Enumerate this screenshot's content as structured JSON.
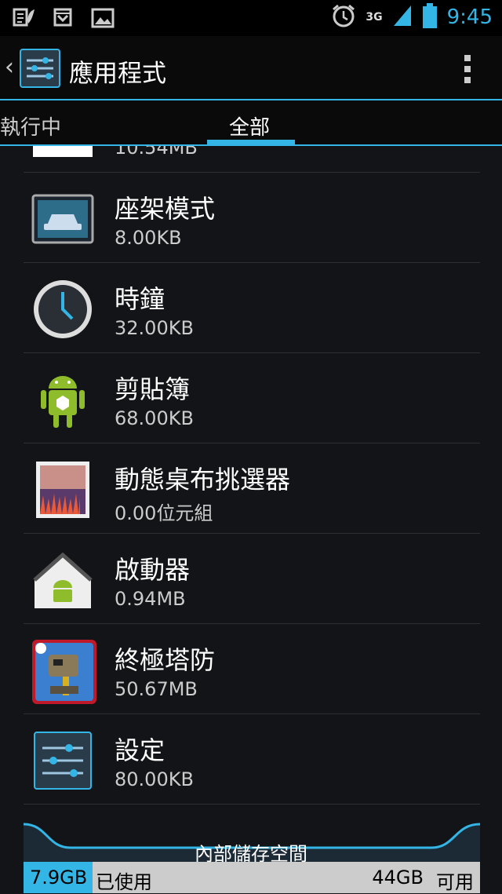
{
  "status_bar": {
    "time": "9:45",
    "network": "3G",
    "icons": [
      "sim-toolkit-icon",
      "download-done-icon",
      "picture-icon",
      "alarm-icon",
      "signal-icon",
      "battery-icon"
    ]
  },
  "action_bar": {
    "title": "應用程式",
    "icon": "settings-icon"
  },
  "tabs": [
    {
      "label": "執行中",
      "selected": false
    },
    {
      "label": "全部",
      "selected": true
    }
  ],
  "apps": [
    {
      "name": "",
      "size": "10.54MB",
      "icon": "app-icon-partial"
    },
    {
      "name": "座架模式",
      "size": "8.00KB",
      "icon": "car-dock-icon"
    },
    {
      "name": "時鐘",
      "size": "32.00KB",
      "icon": "clock-icon"
    },
    {
      "name": "剪貼簿",
      "size": "68.00KB",
      "icon": "android-clipboard-icon"
    },
    {
      "name": "動態桌布挑選器",
      "size": "0.00位元組",
      "icon": "live-wallpaper-icon"
    },
    {
      "name": "啟動器",
      "size": "0.94MB",
      "icon": "launcher-home-icon"
    },
    {
      "name": "終極塔防",
      "size": "50.67MB",
      "icon": "tower-defense-game-icon"
    },
    {
      "name": "設定",
      "size": "80.00KB",
      "icon": "settings-icon"
    }
  ],
  "storage": {
    "label": "內部儲存空間",
    "used": "7.9GB",
    "used_label": "已使用",
    "available": "44GB",
    "available_label": "可用",
    "used_fraction": 0.152,
    "accent": "#33b5e5"
  }
}
